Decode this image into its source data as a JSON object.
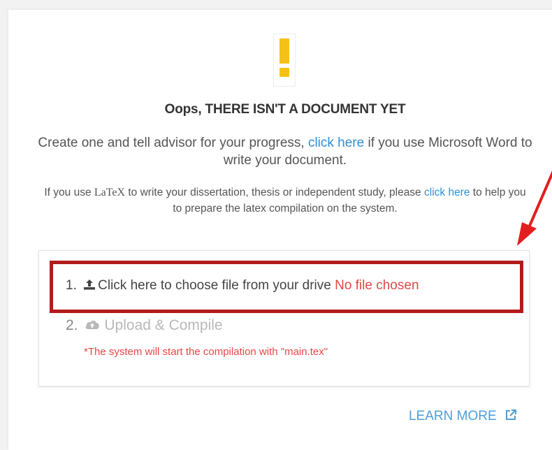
{
  "heading": "Oops, THERE ISN'T A DOCUMENT YET",
  "lead": {
    "before": "Create one and tell advisor for your progress, ",
    "link": "click here",
    "after": " if you use Microsoft Word to write your document."
  },
  "latex_note": {
    "before": "If you use ",
    "logo": "LaTeX",
    "middle": " to write your dissertation, thesis or independent study, please ",
    "link": "click here",
    "after": " to help you to prepare the latex compilation on the system."
  },
  "upload": {
    "step1_number": "1.",
    "step1_label": "Click here to choose file from your drive",
    "file_status": "No file chosen",
    "step2_number": "2.",
    "step2_label": "Upload & Compile",
    "note": "*The system will start the compilation with \"main.tex\""
  },
  "learn_more": "LEARN MORE",
  "icons": {
    "warning": "exclamation-icon",
    "upload": "upload-icon",
    "cloud": "cloud-upload-icon",
    "external": "external-link-icon"
  },
  "colors": {
    "warning": "#f5c116",
    "link": "#2f8fd6",
    "highlight": "#b31b1b",
    "arrow": "#e31e1e",
    "error_text": "#e04747"
  }
}
